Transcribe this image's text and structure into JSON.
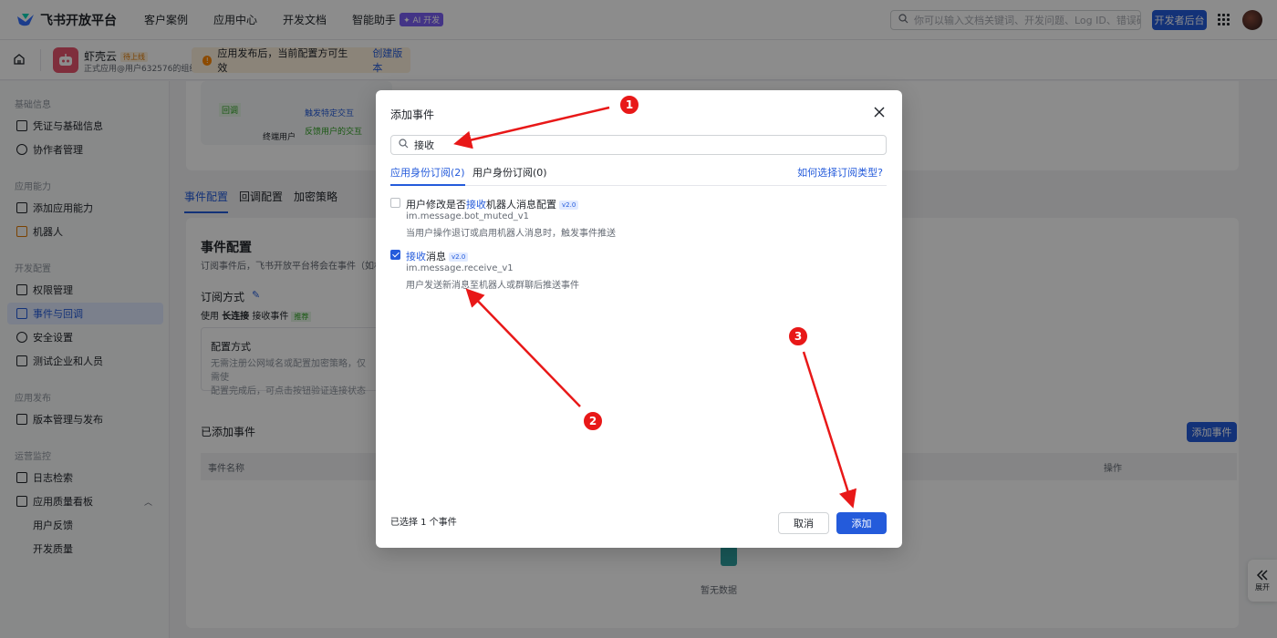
{
  "topnav": {
    "logo_text": "飞书开放平台",
    "items": [
      "客户案例",
      "应用中心",
      "开发文档",
      "智能助手"
    ],
    "ai_badge": "✦ AI 开发",
    "search_placeholder": "你可以输入文档关键词、开发问题、Log ID、错误码",
    "dev_console": "开发者后台"
  },
  "subbar": {
    "app_name": "虾壳云",
    "app_status": "待上线",
    "app_org": "正式应用@用户632576的组织",
    "notice_text": "应用发布后，当前配置方可生效",
    "notice_link": "创建版本"
  },
  "sidebar": {
    "groups": [
      "基础信息",
      "应用能力",
      "开发配置",
      "应用发布",
      "运营监控"
    ],
    "items": [
      "凭证与基础信息",
      "协作者管理",
      "添加应用能力",
      "机器人",
      "权限管理",
      "事件与回调",
      "安全设置",
      "测试企业和人员",
      "版本管理与发布",
      "日志检索",
      "应用质量看板",
      "用户反馈",
      "开发质量"
    ]
  },
  "main": {
    "flow": {
      "tag": "回调",
      "user": "终端用户",
      "line1": "触发特定交互",
      "line2": "反馈用户的交互"
    },
    "tabs": [
      "事件配置",
      "回调配置",
      "加密策略"
    ],
    "title": "事件配置",
    "desc": "订阅事件后，飞书开放平台将会在事件（如机",
    "sub_title": "订阅方式",
    "use_prefix": "使用",
    "use_bold": "长连接",
    "use_suffix": "接收事件",
    "recommend": "推荐",
    "box_title": "配置方式",
    "box_desc1": "无需注册公网域名或配置加密策略，仅需使",
    "box_desc2": "配置完成后，可点击按钮验证连接状态",
    "added_title": "已添加事件",
    "add_button": "添加事件",
    "col_name": "事件名称",
    "col_action": "操作",
    "empty": "暂无数据"
  },
  "expand": "展开",
  "modal": {
    "title": "添加事件",
    "search_value": "接收",
    "tab_app": "应用身份订阅(2)",
    "tab_user": "用户身份订阅(0)",
    "help_link": "如何选择订阅类型?",
    "events": [
      {
        "pre": "用户修改是否",
        "hl": "接收",
        "post": "机器人消息配置",
        "ver": "v2.0",
        "key": "im.message.bot_muted_v1",
        "desc": "当用户操作退订或启用机器人消息时，触发事件推送",
        "checked": false
      },
      {
        "pre": "",
        "hl": "接收",
        "post": "消息",
        "ver": "v2.0",
        "key": "im.message.receive_v1",
        "desc": "用户发送新消息至机器人或群聊后推送事件",
        "checked": true
      }
    ],
    "selected_text": "已选择 1 个事件",
    "cancel": "取消",
    "add": "添加"
  },
  "annotations": {
    "labels": [
      "1",
      "2",
      "3"
    ],
    "color": "#e81818"
  },
  "colors": {
    "primary": "#245bdb",
    "overlay": "rgba(0,0,0,0.45)"
  }
}
